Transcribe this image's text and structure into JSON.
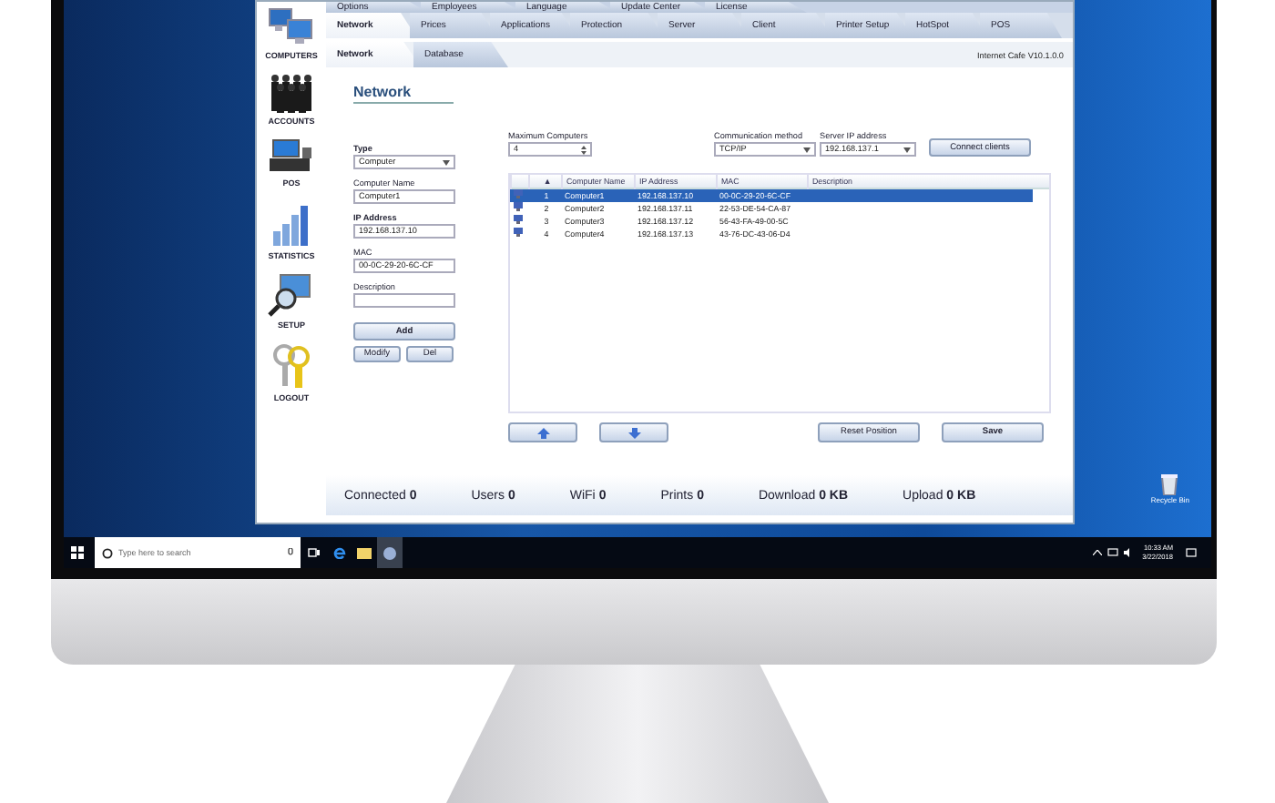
{
  "window": {
    "top_tabs": [
      {
        "label": "Options",
        "selected": false
      },
      {
        "label": "Employees",
        "selected": false
      },
      {
        "label": "Language",
        "selected": false
      },
      {
        "label": "Update Center",
        "selected": false
      },
      {
        "label": "License",
        "selected": false
      }
    ],
    "main_tabs": [
      {
        "label": "Network",
        "selected": true
      },
      {
        "label": "Prices",
        "selected": false
      },
      {
        "label": "Applications",
        "selected": false
      },
      {
        "label": "Protection",
        "selected": false
      },
      {
        "label": "Server",
        "selected": false
      },
      {
        "label": "Client",
        "selected": false
      },
      {
        "label": "Printer Setup",
        "selected": false
      },
      {
        "label": "HotSpot",
        "selected": false
      },
      {
        "label": "POS",
        "selected": false
      }
    ],
    "sub_tabs": [
      {
        "label": "Network",
        "selected": true
      },
      {
        "label": "Database",
        "selected": false
      }
    ],
    "version": "Internet Cafe V10.1.0.0",
    "sidebar": {
      "items": [
        {
          "kind": "computers",
          "label": "COMPUTERS"
        },
        {
          "kind": "accounts",
          "label": "ACCOUNTS"
        },
        {
          "kind": "pos",
          "label": "POS"
        },
        {
          "kind": "statistics",
          "label": "STATISTICS"
        },
        {
          "kind": "setup",
          "label": "SETUP"
        },
        {
          "kind": "logout",
          "label": "LOGOUT"
        }
      ]
    },
    "section_title": "Network",
    "form": {
      "fields": [
        {
          "kind": "select",
          "label": "Type",
          "bold": true,
          "value": "Computer"
        },
        {
          "kind": "text",
          "label": "Computer Name",
          "bold": false,
          "value": "Computer1"
        },
        {
          "kind": "text",
          "label": "IP Address",
          "bold": true,
          "value": "192.168.137.10"
        },
        {
          "kind": "text",
          "label": "MAC",
          "bold": false,
          "value": "00-0C-29-20-6C-CF"
        },
        {
          "kind": "text",
          "label": "Description",
          "bold": false
        }
      ],
      "add_button": "Add",
      "modify_button": "Modify",
      "delete_button": "Del"
    },
    "settings": {
      "max_computers": {
        "label": "Maximum Computers",
        "value": "4"
      },
      "comm_method": {
        "label": "Communication method",
        "value": "TCP/IP"
      },
      "server_ip": {
        "label": "Server IP address",
        "value": "192.168.137.1"
      },
      "connect_button": "Connect clients"
    },
    "table": {
      "sort_mark": "▲",
      "columns": [
        "Computer Name",
        "IP Address",
        "MAC",
        "Description"
      ],
      "rows": [
        {
          "num": "1",
          "name": "Computer1",
          "ip": "192.168.137.10",
          "mac": "00-0C-29-20-6C-CF",
          "selected": true
        },
        {
          "num": "2",
          "name": "Computer2",
          "ip": "192.168.137.11",
          "mac": "22-53-DE-54-CA-87",
          "selected": false
        },
        {
          "num": "3",
          "name": "Computer3",
          "ip": "192.168.137.12",
          "mac": "56-43-FA-49-00-5C",
          "selected": false
        },
        {
          "num": "4",
          "name": "Computer4",
          "ip": "192.168.137.13",
          "mac": "43-76-DC-43-06-D4",
          "selected": false
        }
      ]
    },
    "bottom_buttons": {
      "reset": "Reset Position",
      "save": "Save"
    },
    "status_bar": [
      {
        "label": "Connected",
        "value": "0"
      },
      {
        "label": "Users",
        "value": "0"
      },
      {
        "label": "WiFi",
        "value": "0"
      },
      {
        "label": "Prints",
        "value": "0"
      },
      {
        "label": "Download",
        "value": "0 KB"
      },
      {
        "label": "Upload",
        "value": "0 KB"
      }
    ]
  },
  "desktop": {
    "recycle_bin": "Recycle Bin"
  },
  "taskbar": {
    "search_placeholder": "Type here to search",
    "time": "10:33 AM",
    "date": "3/22/2018"
  }
}
